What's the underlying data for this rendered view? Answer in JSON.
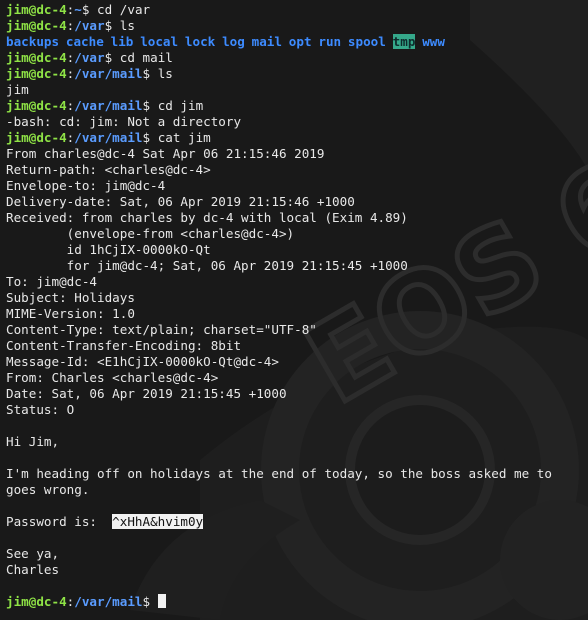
{
  "terminal": {
    "host_user": "jim@dc-4",
    "sep": ":",
    "dollar": "$ ",
    "l1": {
      "path": "~",
      "cmd": "cd /var"
    },
    "l2": {
      "path": "/var",
      "cmd": "ls"
    },
    "ls_var": [
      "backups",
      "cache",
      "lib",
      "local",
      "lock",
      "log",
      "mail",
      "opt",
      "run",
      "spool",
      "tmp",
      "www"
    ],
    "l4": {
      "path": "/var",
      "cmd": "cd mail"
    },
    "l5": {
      "path": "/var/mail",
      "cmd": "ls"
    },
    "ls_mail": "jim",
    "l7": {
      "path": "/var/mail",
      "cmd": "cd jim"
    },
    "l8": "-bash: cd: jim: Not a directory",
    "l9": {
      "path": "/var/mail",
      "cmd": "cat jim"
    },
    "mail": {
      "from_line": "From charles@dc-4 Sat Apr 06 21:15:46 2019",
      "return_path": "Return-path: <charles@dc-4>",
      "envelope_to": "Envelope-to: jim@dc-4",
      "delivery_date": "Delivery-date: Sat, 06 Apr 2019 21:15:46 +1000",
      "received_1": "Received: from charles by dc-4 with local (Exim 4.89)",
      "received_2": "        (envelope-from <charles@dc-4>)",
      "received_3": "        id 1hCjIX-0000kO-Qt",
      "received_4": "        for jim@dc-4; Sat, 06 Apr 2019 21:15:45 +1000",
      "to": "To: jim@dc-4",
      "subject": "Subject: Holidays",
      "mime": "MIME-Version: 1.0",
      "content_type": "Content-Type: text/plain; charset=\"UTF-8\"",
      "encoding": "Content-Transfer-Encoding: 8bit",
      "message_id": "Message-Id: <E1hCjIX-0000kO-Qt@dc-4>",
      "from": "From: Charles <charles@dc-4>",
      "date": "Date: Sat, 06 Apr 2019 21:15:45 +1000",
      "status": "Status: O",
      "greeting": "Hi Jim,",
      "body_1": "I'm heading off on holidays at the end of today, so the boss asked me to",
      "body_2": "goes wrong.",
      "password_label": "Password is:  ",
      "password_value": "^xHhA&hvim0y",
      "signoff": "See ya,",
      "signature": "Charles"
    },
    "final": {
      "path": "/var/mail"
    }
  },
  "colors": {
    "prompt_user": "#8fe346",
    "prompt_path": "#5a9cff",
    "ls_dir": "#3d8bff",
    "sticky_dir_bg": "#35a88a"
  }
}
